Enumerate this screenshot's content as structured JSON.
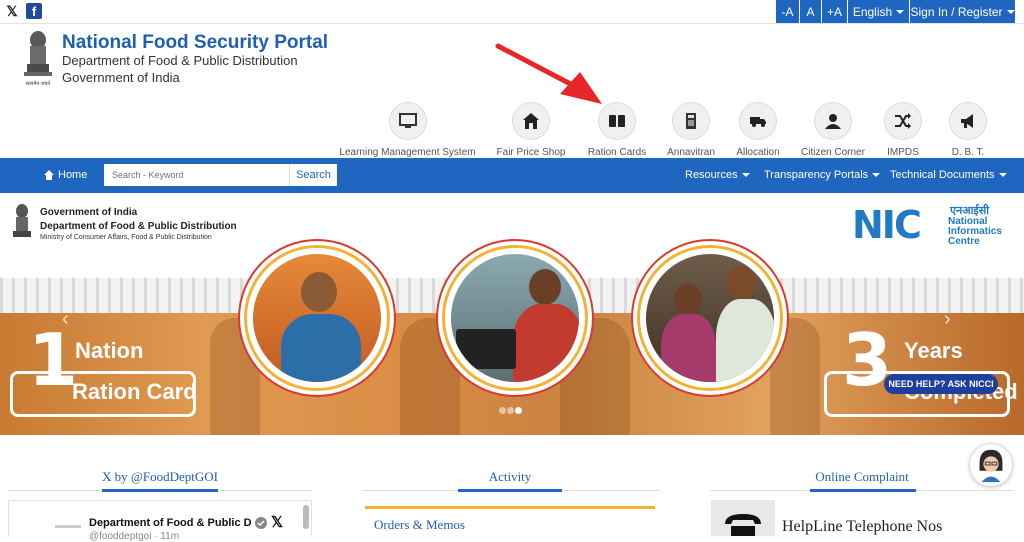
{
  "topbar": {
    "social": [
      "x-icon",
      "facebook-icon"
    ],
    "font_decrease": "-A",
    "font_normal": "A",
    "font_increase": "+A",
    "language": "English",
    "signin": "Sign In / Register"
  },
  "header": {
    "title": "National Food Security Portal",
    "subtitle1": "Department of Food & Public Distribution",
    "subtitle2": "Government of India"
  },
  "quick_links": [
    {
      "label": "Learning Management System",
      "icon": "monitor-icon"
    },
    {
      "label": "Fair Price Shop",
      "icon": "shop-icon"
    },
    {
      "label": "Ration Cards",
      "icon": "card-icon"
    },
    {
      "label": "Annavitran",
      "icon": "pos-device-icon"
    },
    {
      "label": "Allocation",
      "icon": "truck-icon"
    },
    {
      "label": "Citizen Corner",
      "icon": "user-icon"
    },
    {
      "label": "IMPDS",
      "icon": "shuffle-icon"
    },
    {
      "label": "D. B. T.",
      "icon": "megaphone-icon"
    }
  ],
  "nav": {
    "home": "Home",
    "search_placeholder": "Search - Keyword",
    "search_button": "Search",
    "menus": [
      "Resources",
      "Transparency Portals",
      "Technical Documents"
    ]
  },
  "banner": {
    "gov_line1": "Government of India",
    "gov_line2": "Department of Food & Public Distribution",
    "gov_line3": "Ministry of Consumer Affairs, Food & Public Distribution",
    "nic_logo": "NIC",
    "nic_hindi": "एनआईसी",
    "nic_text": "National Informatics Centre",
    "left_number": "1",
    "left_line1": "Nation",
    "left_line2": "Ration Card",
    "right_number": "3",
    "right_line1": "Years",
    "right_line2": "Completed",
    "help_badge": "NEED HELP? ASK NICCI"
  },
  "sections": {
    "x_title": "X by @FoodDeptGOI",
    "x_card_name": "Department of Food & Public D",
    "x_card_handle": "@fooddeptgoi · 11m",
    "activity_title": "Activity",
    "orders_label": "Orders & Memos",
    "complaint_title": "Online Complaint",
    "helpline_label": "HelpLine Telephone Nos"
  },
  "colors": {
    "primary_blue": "#1f66c1",
    "title_blue": "#1f5fb2",
    "accent_yellow": "#f2b233",
    "accent_red": "#d93a2e"
  }
}
